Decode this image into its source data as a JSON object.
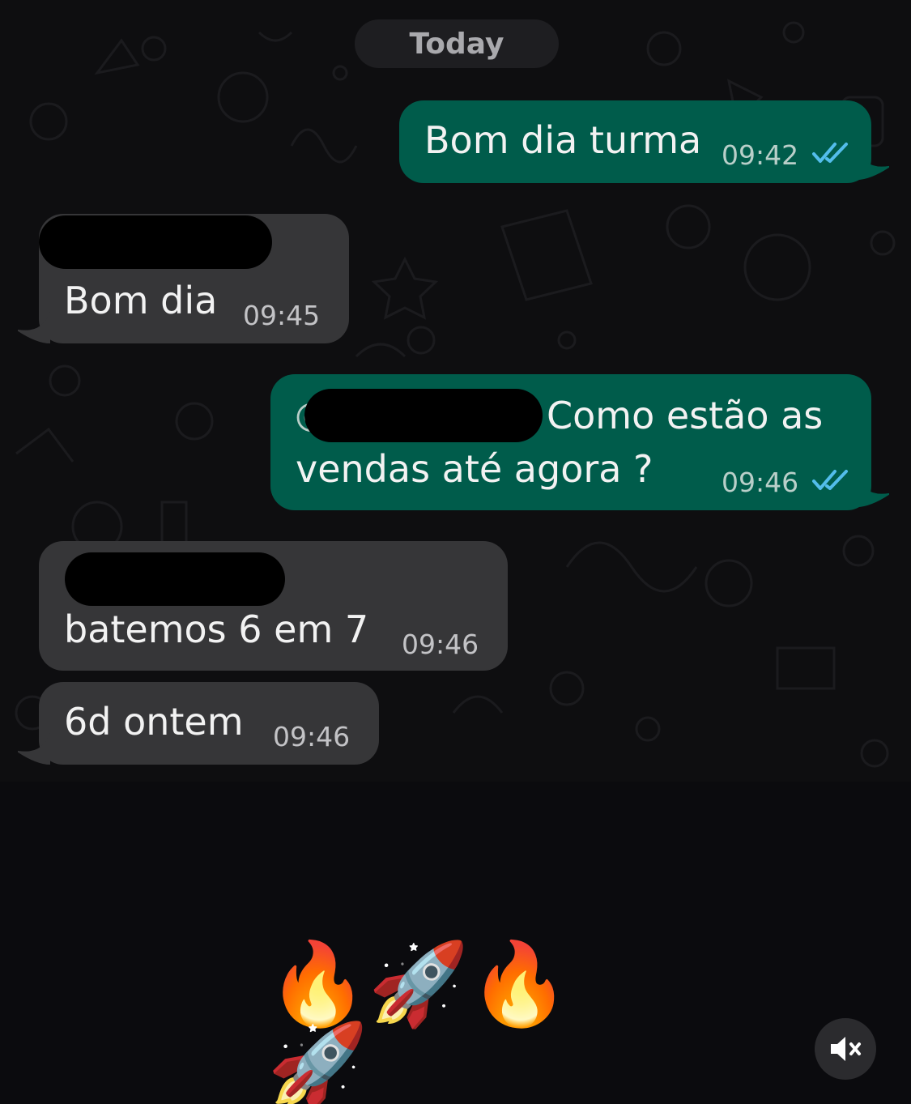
{
  "date_separator": "Today",
  "messages": [
    {
      "direction": "outgoing",
      "text": "Bom dia turma",
      "time": "09:42",
      "status": "read"
    },
    {
      "direction": "incoming",
      "sender_redacted": true,
      "text": "Bom dia",
      "time": "09:45"
    },
    {
      "direction": "outgoing",
      "mention_redacted": true,
      "text_line1": "Como estão as",
      "text_line2": "vendas até agora ?",
      "time": "09:46",
      "status": "read"
    },
    {
      "direction": "incoming",
      "sender_redacted": true,
      "text": "batemos  6 em 7",
      "time": "09:46"
    },
    {
      "direction": "incoming",
      "text": "6d ontem",
      "time": "09:46"
    }
  ],
  "caption_emojis": "🔥🚀🔥🚀",
  "icons": {
    "read_ticks": "double-check-icon",
    "mention": "at-icon",
    "mute": "speaker-muted-icon"
  },
  "colors": {
    "outgoing_bubble": "#005c4b",
    "incoming_bubble": "#363638",
    "read_ticks": "#53bdeb",
    "background": "#0b0b0e"
  }
}
